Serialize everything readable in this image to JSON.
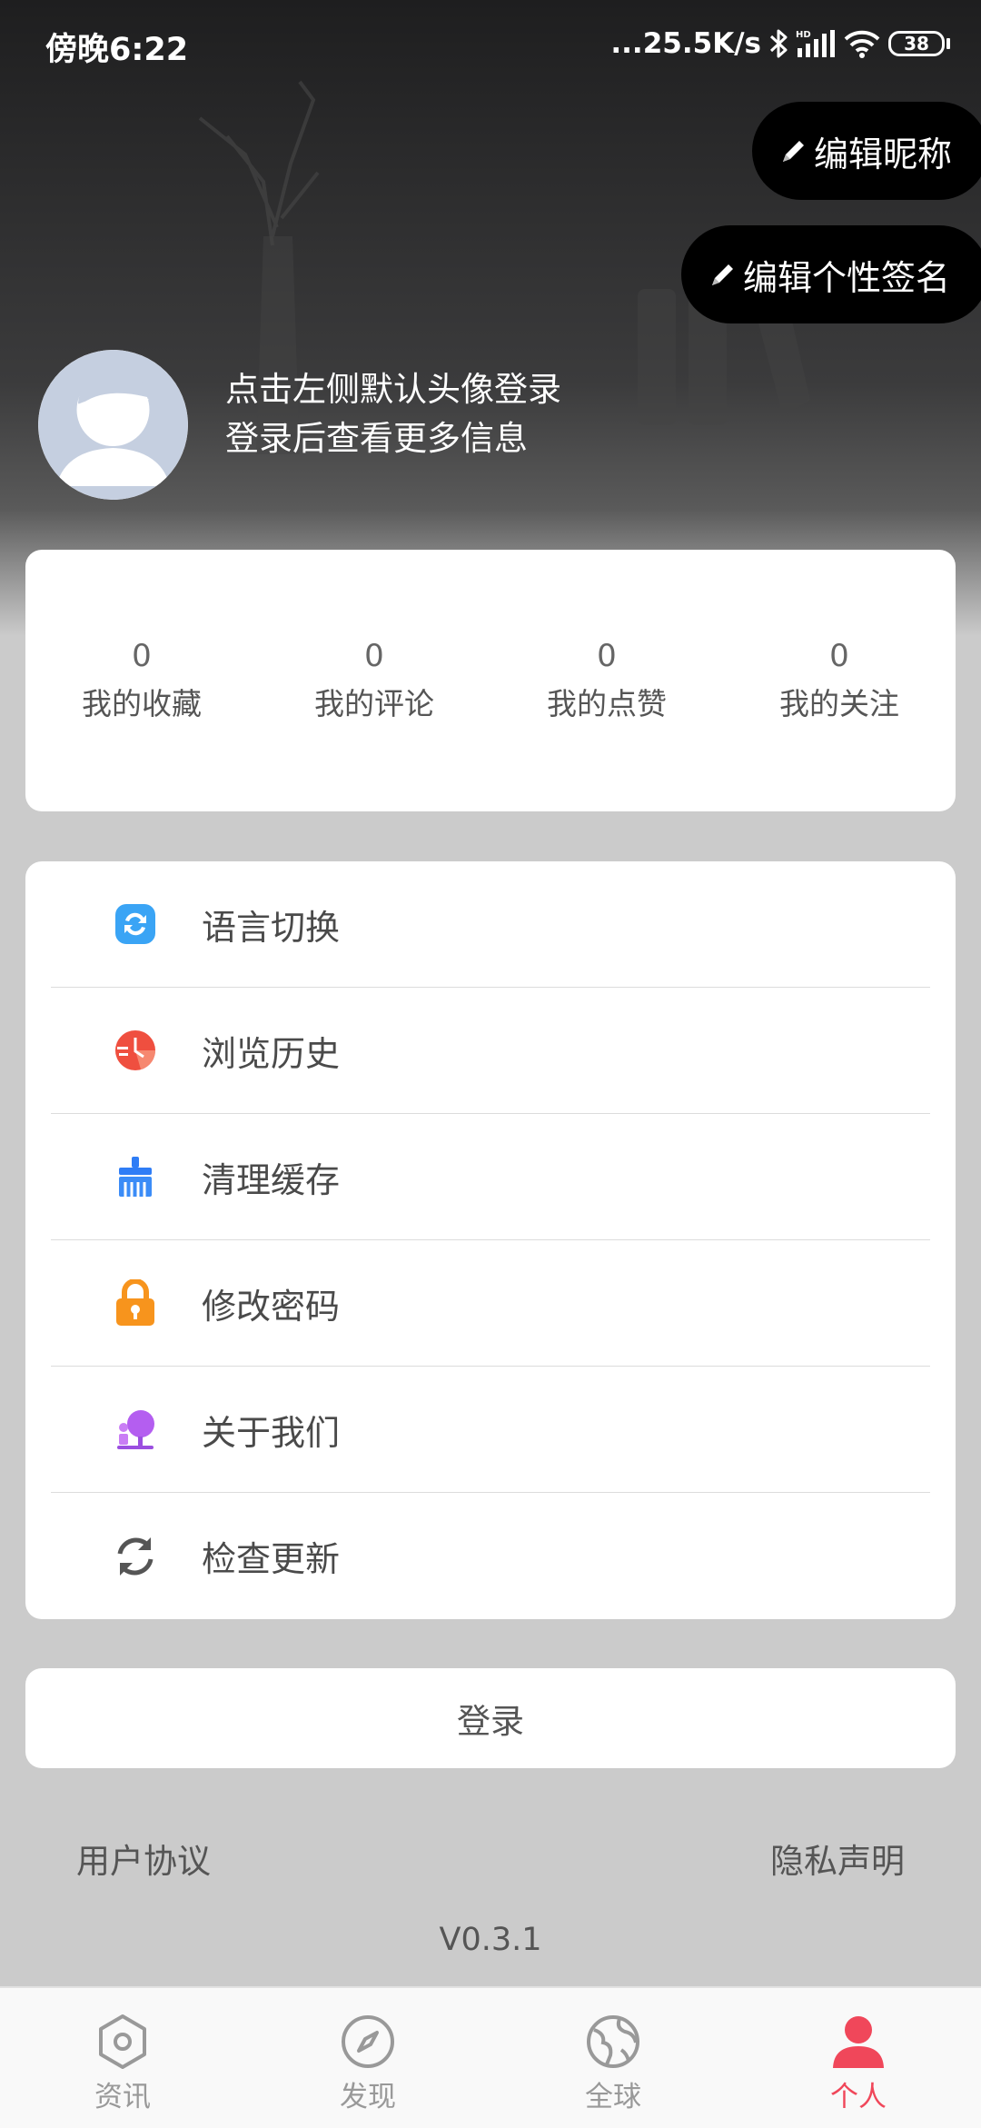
{
  "status_bar": {
    "time": "傍晚6:22",
    "network_speed": "...25.5K/s",
    "battery": "38",
    "icons": [
      "bluetooth-icon",
      "signal-icon",
      "wifi-icon",
      "battery-icon"
    ]
  },
  "header": {
    "edit_nickname": "编辑昵称",
    "edit_signature": "编辑个性签名",
    "login_tip_line1": "点击左侧默认头像登录",
    "login_tip_line2": "登录后查看更多信息"
  },
  "stats": [
    {
      "value": "0",
      "label": "我的收藏"
    },
    {
      "value": "0",
      "label": "我的评论"
    },
    {
      "value": "0",
      "label": "我的点赞"
    },
    {
      "value": "0",
      "label": "我的关注"
    }
  ],
  "menu": [
    {
      "label": "语言切换",
      "icon": "language-switch-icon"
    },
    {
      "label": "浏览历史",
      "icon": "history-clock-icon"
    },
    {
      "label": "清理缓存",
      "icon": "broom-icon"
    },
    {
      "label": "修改密码",
      "icon": "lock-icon"
    },
    {
      "label": "关于我们",
      "icon": "about-us-icon"
    },
    {
      "label": "检查更新",
      "icon": "refresh-icon"
    }
  ],
  "login_button": "登录",
  "footer": {
    "user_agreement": "用户协议",
    "privacy_statement": "隐私声明",
    "version": "V0.3.1"
  },
  "tabbar": {
    "tabs": [
      {
        "label": "资讯",
        "icon": "hexagon-icon"
      },
      {
        "label": "发现",
        "icon": "compass-icon"
      },
      {
        "label": "全球",
        "icon": "globe-icon"
      },
      {
        "label": "个人",
        "icon": "person-icon"
      }
    ],
    "active": "个人",
    "active_color": "#f0475a"
  },
  "colors": {
    "header_dark": "#1e1e1f",
    "page_background": "#cbcbcb",
    "card_background": "#ffffff"
  }
}
